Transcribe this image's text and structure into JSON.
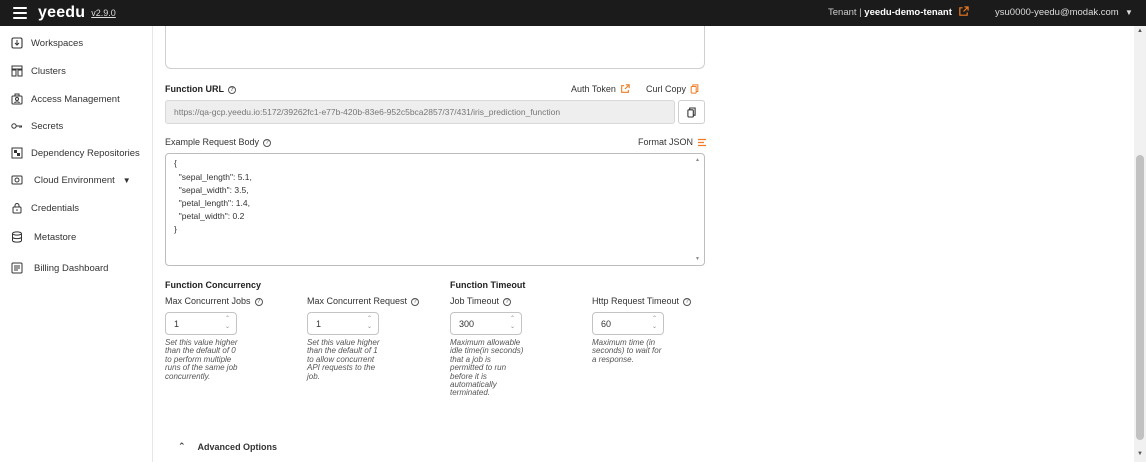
{
  "app": {
    "brand": "yeedu",
    "version": "v2.9.0",
    "tenant_prefix": "Tenant | ",
    "tenant_name": "yeedu-demo-tenant",
    "user": "ysu0000-yeedu@modak.com"
  },
  "sidebar": {
    "items": [
      {
        "label": "Workspaces",
        "icon": "workspace-icon"
      },
      {
        "label": "Clusters",
        "icon": "clusters-icon"
      },
      {
        "label": "Access Management",
        "icon": "access-management-icon"
      },
      {
        "label": "Secrets",
        "icon": "key-icon"
      },
      {
        "label": "Dependency Repositories",
        "icon": "repository-icon"
      },
      {
        "label": "Cloud Environment",
        "icon": "cloud-environment-icon"
      },
      {
        "label": "Credentials",
        "icon": "lock-icon"
      },
      {
        "label": "Metastore",
        "icon": "database-icon"
      },
      {
        "label": "Billing Dashboard",
        "icon": "billing-icon"
      }
    ]
  },
  "function_url": {
    "label": "Function URL",
    "auth_token_label": "Auth Token",
    "curl_copy_label": "Curl Copy",
    "value": "https://qa-gcp.yeedu.io:5172/39262fc1-e77b-420b-83e6-952c5bca2857/37/431/iris_prediction_function"
  },
  "request_body": {
    "label": "Example Request Body",
    "format_label": "Format JSON",
    "lines": [
      "{",
      "  \"sepal_length\": 5.1,",
      "  \"sepal_width\": 3.5,",
      "  \"petal_length\": 1.4,",
      "  \"petal_width\": 0.2",
      "}"
    ]
  },
  "concurrency": {
    "title": "Function Concurrency",
    "max_jobs_label": "Max Concurrent Jobs",
    "max_jobs_value": "1",
    "max_jobs_hint": "Set this value higher than the default of 0 to perform multiple runs of the same job concurrently.",
    "max_requests_label": "Max Concurrent Request",
    "max_requests_value": "1",
    "max_requests_hint": "Set this value higher than the default of 1 to allow concurrent API requests to the job."
  },
  "timeout": {
    "title": "Function Timeout",
    "job_timeout_label": "Job Timeout",
    "job_timeout_value": "300",
    "job_timeout_hint": "Maximum allowable idle time(in seconds) that a job is permitted to run before it is automatically terminated.",
    "http_timeout_label": "Http Request Timeout",
    "http_timeout_value": "60",
    "http_timeout_hint": "Maximum time (in seconds) to wait for a response."
  },
  "advanced": {
    "label": "Advanced Options"
  },
  "colors": {
    "topbar": "#1b1b1b",
    "accent": "#f07b22"
  }
}
